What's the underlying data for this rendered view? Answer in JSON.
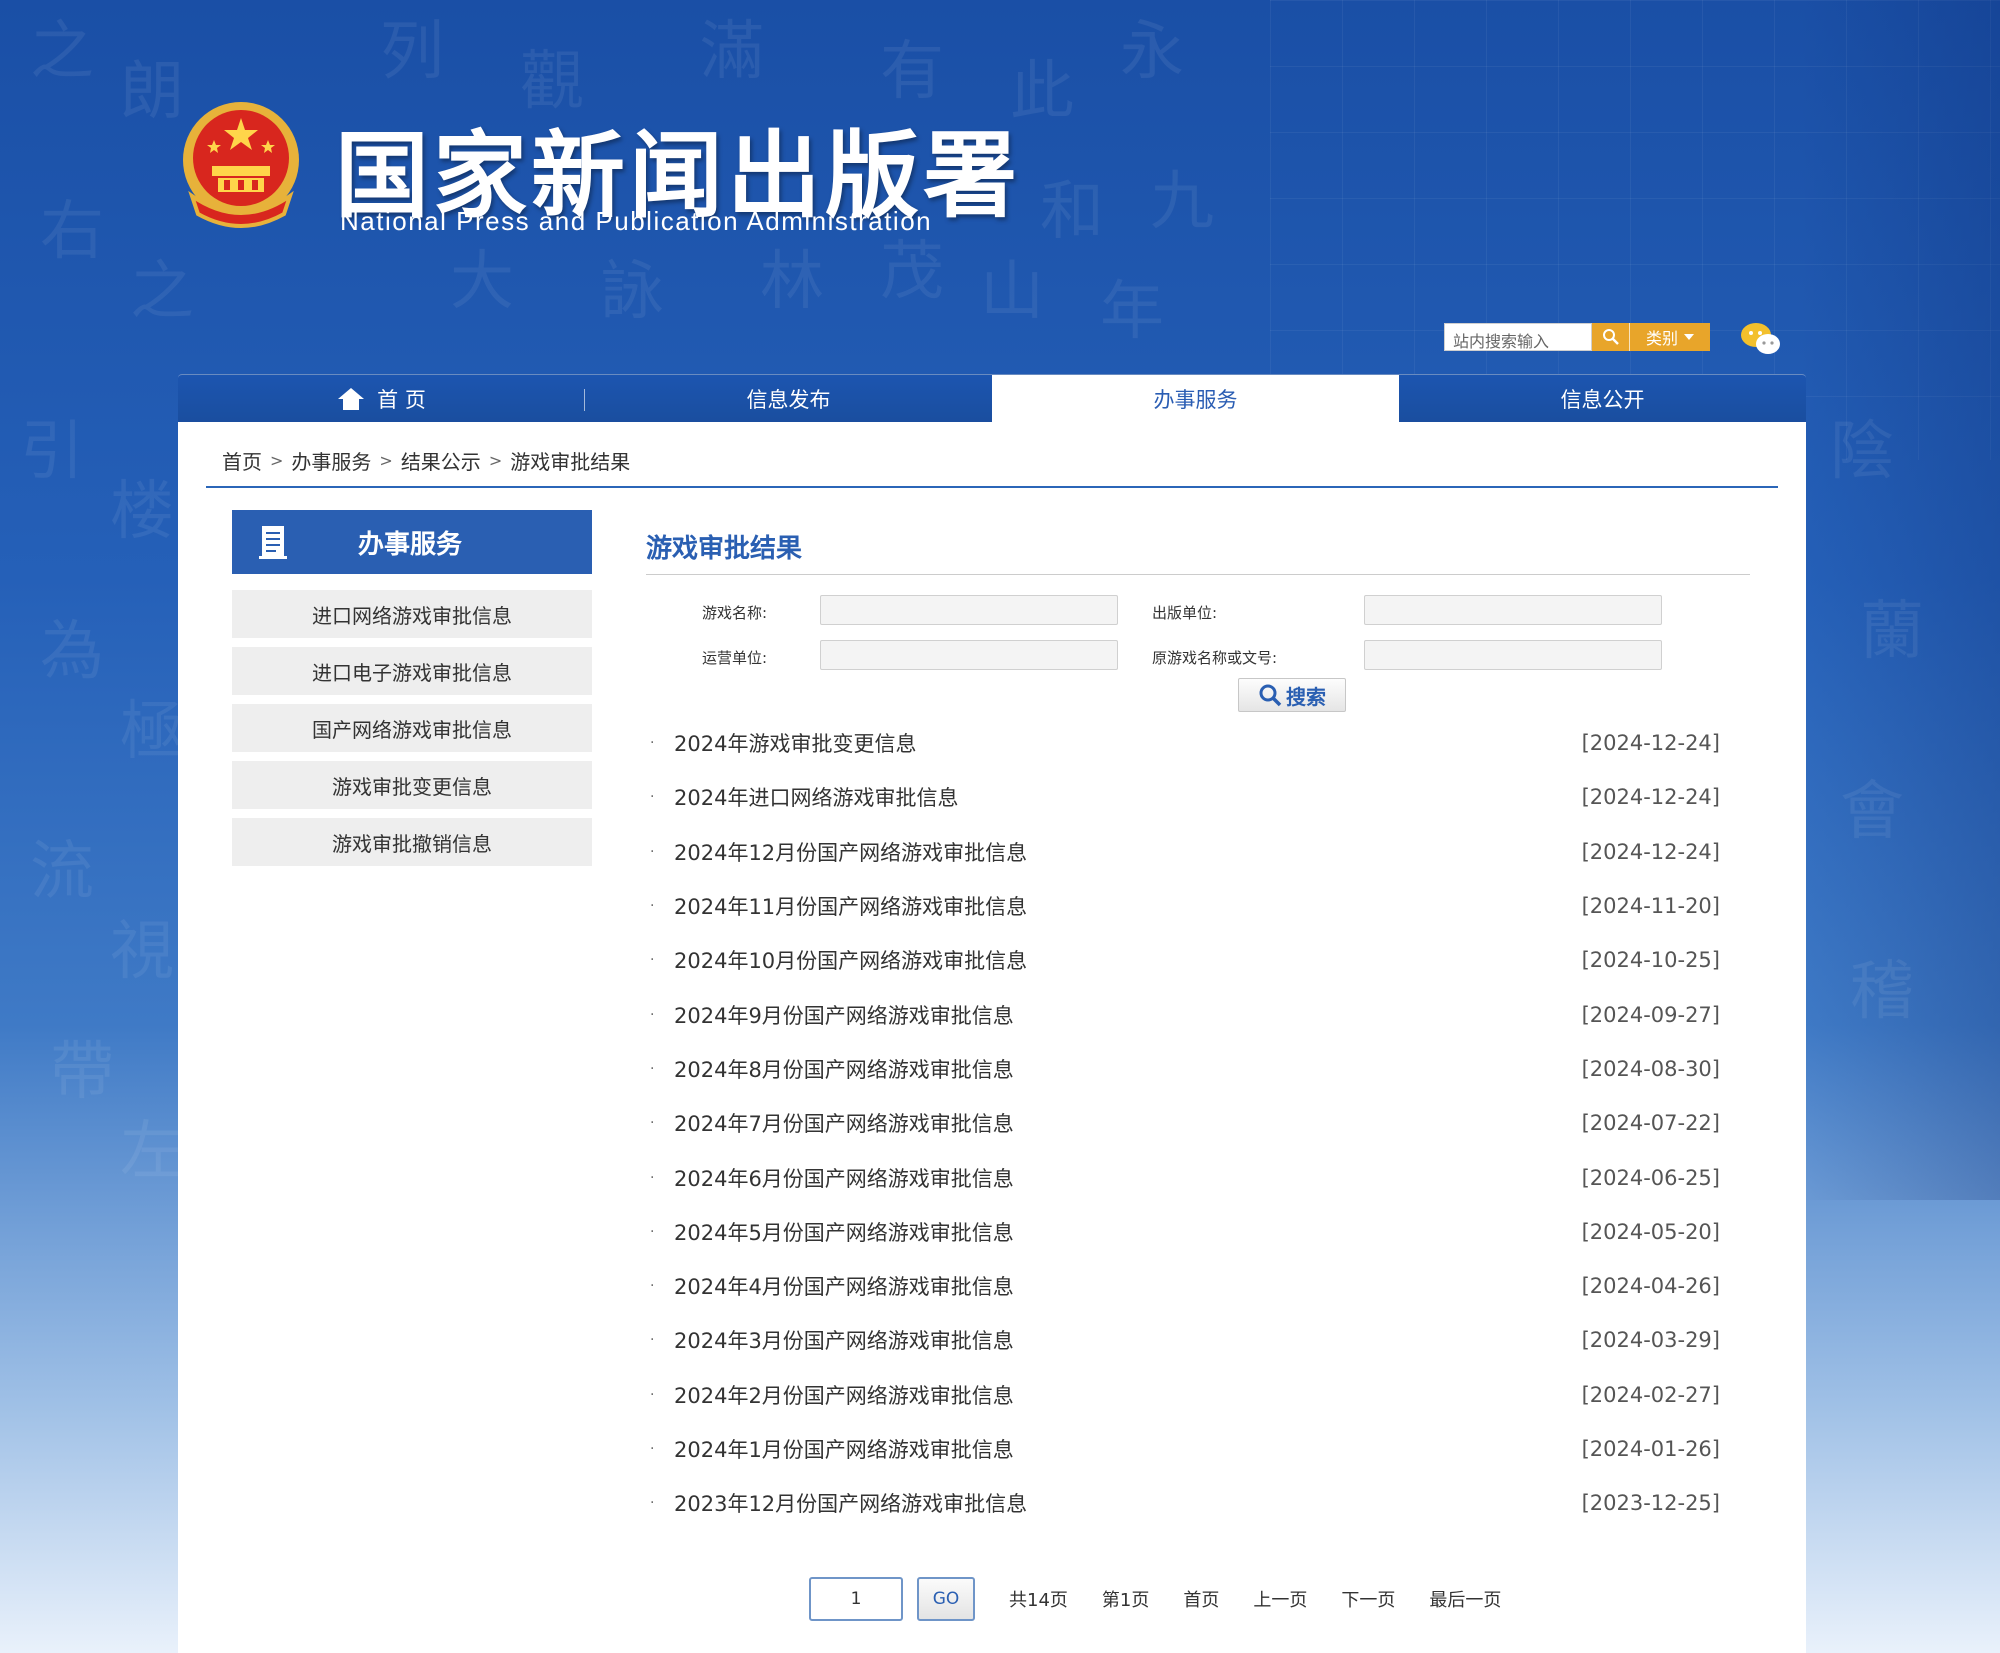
{
  "header": {
    "title_cn": "国家新闻出版署",
    "title_en": "National  Press and Publication Administration",
    "search_placeholder": "站内搜索输入",
    "category_label": "类别"
  },
  "nav": {
    "items": [
      {
        "label": "首 页"
      },
      {
        "label": "信息发布"
      },
      {
        "label": "办事服务"
      },
      {
        "label": "信息公开"
      }
    ]
  },
  "breadcrumb": [
    "首页",
    "办事服务",
    "结果公示",
    "游戏审批结果"
  ],
  "breadcrumb_separator": ">",
  "sidebar": {
    "title": "办事服务",
    "items": [
      {
        "label": "进口网络游戏审批信息"
      },
      {
        "label": "进口电子游戏审批信息"
      },
      {
        "label": "国产网络游戏审批信息"
      },
      {
        "label": "游戏审批变更信息"
      },
      {
        "label": "游戏审批撤销信息"
      }
    ]
  },
  "main": {
    "title": "游戏审批结果",
    "filters": {
      "game_name": "游戏名称:",
      "publisher": "出版单位:",
      "operator": "运营单位:",
      "original": "原游戏名称或文号:",
      "search_button": "搜索"
    },
    "bullet": "·",
    "list": [
      {
        "title": "2024年游戏审批变更信息",
        "date": "[2024-12-24]"
      },
      {
        "title": "2024年进口网络游戏审批信息",
        "date": "[2024-12-24]"
      },
      {
        "title": "2024年12月份国产网络游戏审批信息",
        "date": "[2024-12-24]"
      },
      {
        "title": "2024年11月份国产网络游戏审批信息",
        "date": "[2024-11-20]"
      },
      {
        "title": "2024年10月份国产网络游戏审批信息",
        "date": "[2024-10-25]"
      },
      {
        "title": "2024年9月份国产网络游戏审批信息",
        "date": "[2024-09-27]"
      },
      {
        "title": "2024年8月份国产网络游戏审批信息",
        "date": "[2024-08-30]"
      },
      {
        "title": "2024年7月份国产网络游戏审批信息",
        "date": "[2024-07-22]"
      },
      {
        "title": "2024年6月份国产网络游戏审批信息",
        "date": "[2024-06-25]"
      },
      {
        "title": "2024年5月份国产网络游戏审批信息",
        "date": "[2024-05-20]"
      },
      {
        "title": "2024年4月份国产网络游戏审批信息",
        "date": "[2024-04-26]"
      },
      {
        "title": "2024年3月份国产网络游戏审批信息",
        "date": "[2024-03-29]"
      },
      {
        "title": "2024年2月份国产网络游戏审批信息",
        "date": "[2024-02-27]"
      },
      {
        "title": "2024年1月份国产网络游戏审批信息",
        "date": "[2024-01-26]"
      },
      {
        "title": "2023年12月份国产网络游戏审批信息",
        "date": "[2023-12-25]"
      }
    ]
  },
  "pager": {
    "page_input": "1",
    "go": "GO",
    "total": "共14页",
    "current": "第1页",
    "first": "首页",
    "prev": "上一页",
    "next": "下一页",
    "last": "最后一页"
  },
  "colors": {
    "brand_blue": "#2a5fb2",
    "search_orange": "#e8a52a"
  },
  "icons": {
    "emblem": "national-emblem-icon",
    "search": "search-icon",
    "wechat": "wechat-icon",
    "home": "home-icon",
    "sidebar": "document-icon"
  }
}
